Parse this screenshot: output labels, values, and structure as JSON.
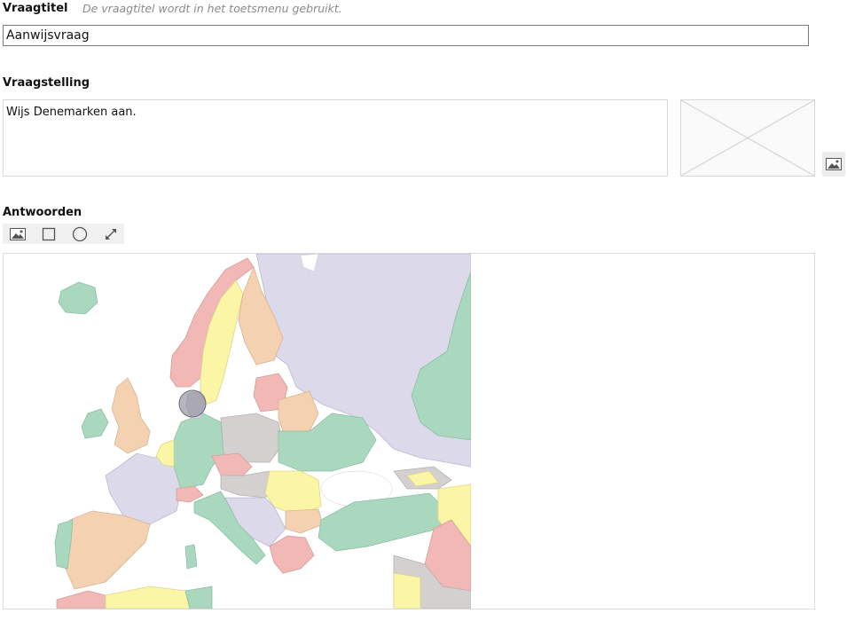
{
  "title_section": {
    "label": "Vraagtitel",
    "hint": "De vraagtitel wordt in het toetsmenu gebruikt.",
    "value": "Aanwijsvraag"
  },
  "question_section": {
    "label": "Vraagstelling",
    "text": "Wijs Denemarken aan.",
    "image_placeholder": "empty-image-placeholder",
    "add_image_icon": "image-icon"
  },
  "answers_section": {
    "label": "Antwoorden",
    "toolbar": [
      "image-icon",
      "rectangle-icon",
      "circle-icon",
      "expand-icon"
    ],
    "map_icon": "europe-map",
    "colors": {
      "sea": "#ffffff",
      "green": "#a9d8bf",
      "purple": "#dcd9ea",
      "orange": "#f4d2b1",
      "yellow": "#fbf5a6",
      "pink": "#f1b8b6",
      "gray": "#d3d0cf",
      "marker": "#8e8e96"
    }
  }
}
